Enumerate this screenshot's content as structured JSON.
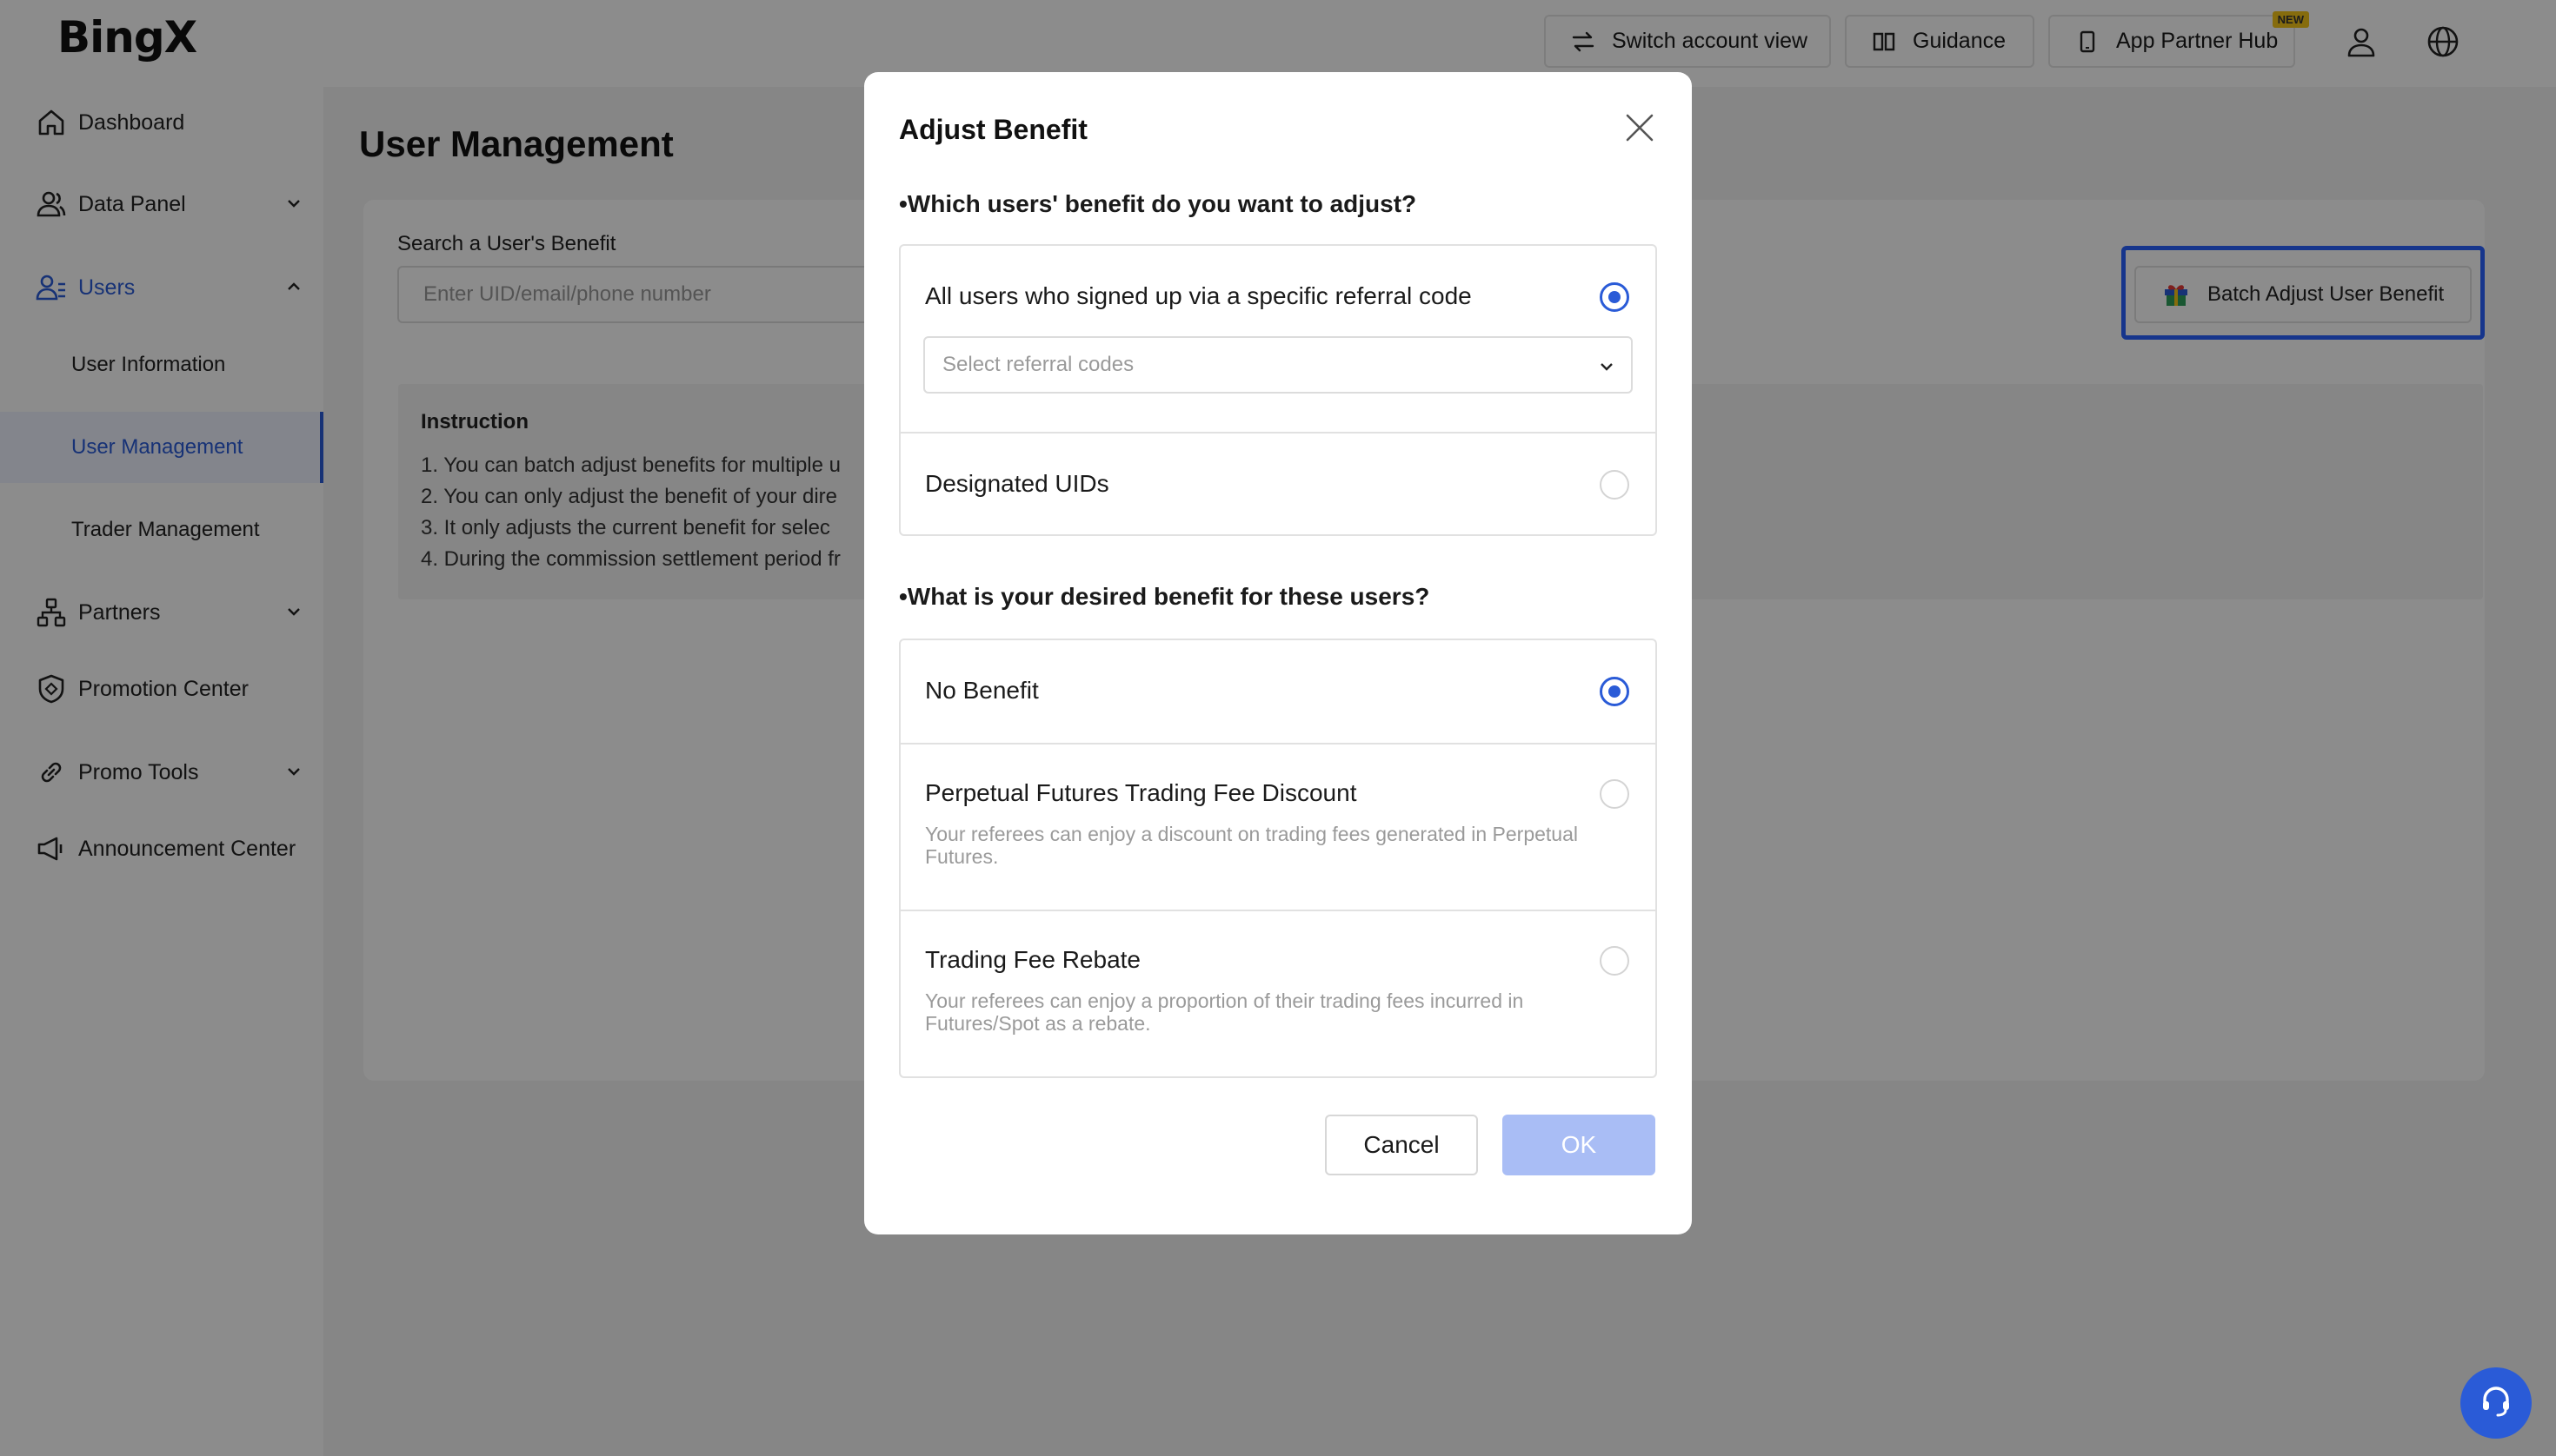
{
  "brand": {
    "logo": "BingX"
  },
  "header": {
    "switch_account": "Switch account view",
    "guidance": "Guidance",
    "app_partner_hub": "App Partner Hub",
    "new_badge": "NEW"
  },
  "sidebar": {
    "dashboard": "Dashboard",
    "data_panel": "Data Panel",
    "users": "Users",
    "user_information": "User Information",
    "user_management": "User Management",
    "trader_management": "Trader Management",
    "partners": "Partners",
    "promotion_center": "Promotion Center",
    "promo_tools": "Promo Tools",
    "announcement_center": "Announcement Center"
  },
  "main": {
    "title": "User Management",
    "search_label": "Search a User's Benefit",
    "search_placeholder": "Enter UID/email/phone number",
    "batch_button": "Batch Adjust User Benefit",
    "instruction_title": "Instruction",
    "instructions": [
      "1. You can batch adjust benefits for multiple u",
      "2. You can only adjust the benefit of your dire",
      "3. It only adjusts the current benefit for selec",
      "4. During the commission settlement period fr"
    ]
  },
  "modal": {
    "title": "Adjust Benefit",
    "question1": "•Which users' benefit do you want to adjust?",
    "target_options": [
      {
        "label": "All users who signed up via a specific referral code",
        "selected": true
      },
      {
        "label": "Designated UIDs",
        "selected": false
      }
    ],
    "referral_placeholder": "Select referral codes",
    "question2": "•What is your desired benefit for these users?",
    "benefit_options": [
      {
        "label": "No Benefit",
        "desc": "",
        "selected": true
      },
      {
        "label": "Perpetual Futures Trading Fee Discount",
        "desc": "Your referees can enjoy a discount on trading fees generated in Perpetual Futures.",
        "selected": false
      },
      {
        "label": "Trading Fee Rebate",
        "desc": "Your referees can enjoy a proportion of their trading fees incurred in Futures/Spot as a rebate.",
        "selected": false
      }
    ],
    "cancel": "Cancel",
    "ok": "OK"
  },
  "colors": {
    "accent": "#2a5bd7",
    "highlight": "#2962ff",
    "ok_disabled": "#a9bdf5"
  }
}
